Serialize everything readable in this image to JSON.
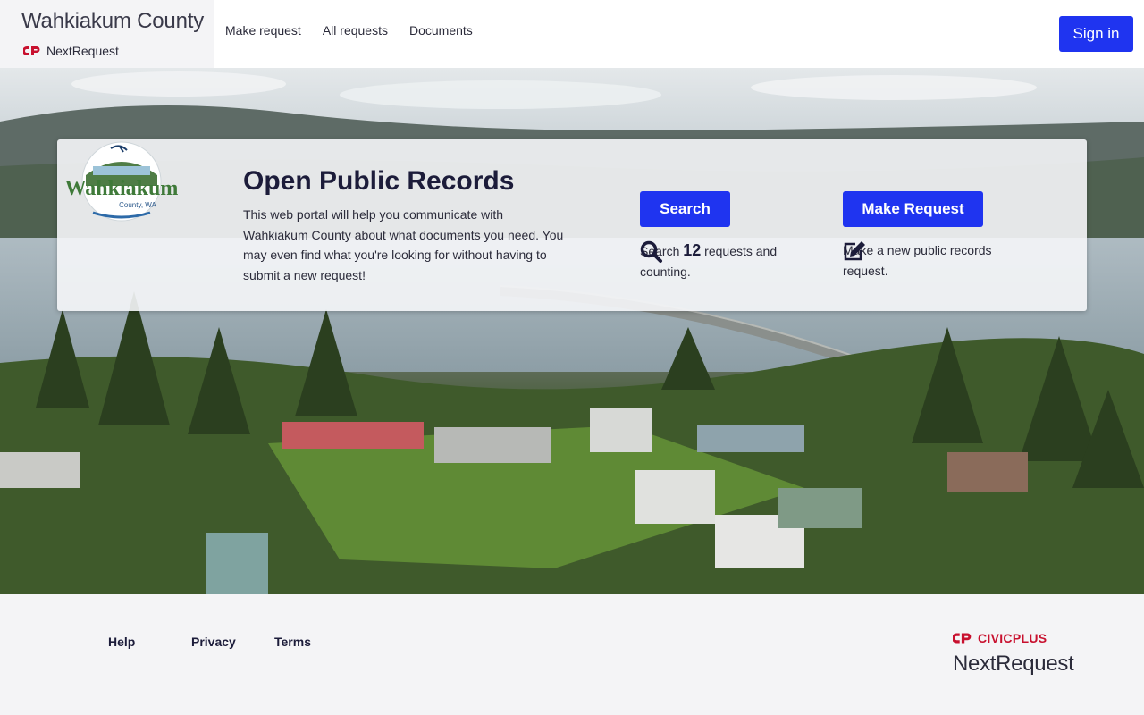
{
  "brand": {
    "title": "Wahkiakum County",
    "product": "NextRequest"
  },
  "nav": {
    "items": [
      "Make request",
      "All requests",
      "Documents"
    ]
  },
  "header": {
    "signin_label": "Sign in"
  },
  "card": {
    "title": "Open Public Records",
    "description": "This web portal will help you communicate with Wahkiakum County about what documents you need. You may even find what you're looking for without having to submit a new request!",
    "logo_text": "Wahkiakum",
    "logo_subtext": "County, WA",
    "search_button": "Search",
    "make_button": "Make Request",
    "search_prefix": "Search",
    "search_count": "12",
    "search_suffix": "requests and counting.",
    "make_text": "Make a new public records request."
  },
  "footer": {
    "links": [
      "Help",
      "Privacy",
      "Terms"
    ],
    "civicplus": "CIVICPLUS",
    "nextrequest": "NextRequest"
  },
  "colors": {
    "primary": "#1f34f0",
    "brand_red": "#c8102e",
    "text_dark": "#1c1c3a"
  },
  "icons": {
    "search": "magnifier-icon",
    "make": "edit-icon",
    "cp_logo": "civicplus-logo-icon"
  }
}
